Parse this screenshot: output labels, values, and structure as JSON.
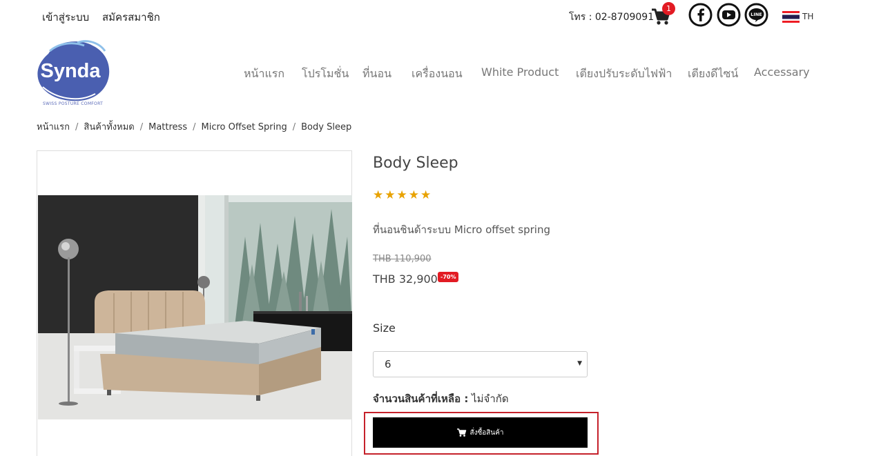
{
  "topbar": {
    "login": "เข้าสู่ระบบ",
    "register": "สมัครสมาชิก",
    "phone": "โทร : 02-8709091",
    "cart_count": "1",
    "lang": "TH"
  },
  "logo": {
    "name": "Synda",
    "tagline": "SWISS POSTURE COMFORT"
  },
  "nav": {
    "items": [
      "หน้าแรก",
      "โปรโมชั่น",
      "ที่นอน",
      "เครื่องนอน",
      "White Product",
      "เตียงปรับระดับไฟฟ้า",
      "เตียงดีไซน์",
      "Accessary"
    ]
  },
  "breadcrumb": [
    "หน้าแรก",
    "สินค้าทั้งหมด",
    "Mattress",
    "Micro Offset Spring",
    "Body Sleep"
  ],
  "product": {
    "title": "Body Sleep",
    "stars": "★★★★★",
    "rating": 5,
    "description": "ที่นอนชินด้าระบบ Micro offset spring",
    "old_price": "THB 110,900",
    "price": "THB 32,900",
    "discount": "-70%",
    "size_label": "Size",
    "size_value": "6",
    "stock_label": "จำนวนสินค้าที่เหลือ :",
    "stock_value": "ไม่จำกัด",
    "buy_label": "สั่งซื้อสินค้า"
  },
  "icons": {
    "cart": "cart-icon",
    "facebook": "facebook-icon",
    "youtube": "youtube-icon",
    "line": "line-icon",
    "flag": "thai-flag-icon",
    "dropdown": "chevron-down-icon"
  },
  "colors": {
    "badge_red": "#e21b23",
    "star": "#e8a200",
    "highlight_border": "#c5202a",
    "button": "#000000"
  }
}
